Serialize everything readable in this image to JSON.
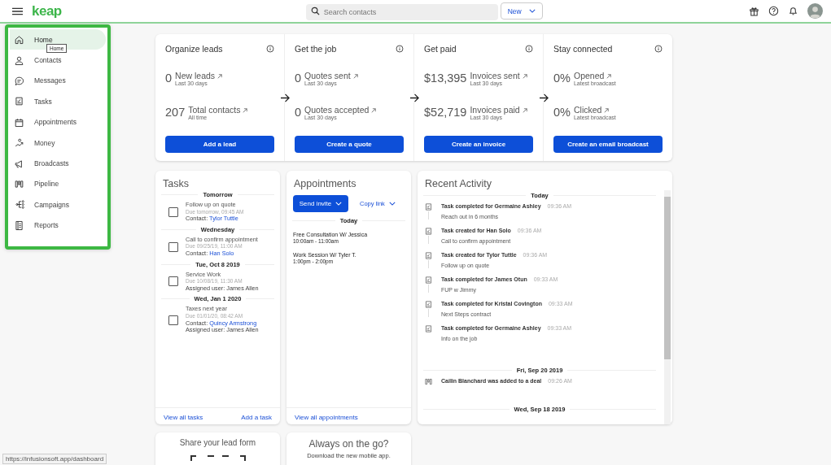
{
  "topbar": {
    "logo": "keap",
    "search": {
      "placeholder": "Search contacts"
    },
    "new_button": "New"
  },
  "sidebar": {
    "items": [
      {
        "label": "Home",
        "selected": true
      },
      {
        "label": "Contacts",
        "selected": false
      },
      {
        "label": "Messages",
        "selected": false
      },
      {
        "label": "Tasks",
        "selected": false
      },
      {
        "label": "Appointments",
        "selected": false
      },
      {
        "label": "Money",
        "selected": false
      },
      {
        "label": "Broadcasts",
        "selected": false
      },
      {
        "label": "Pipeline",
        "selected": false
      },
      {
        "label": "Campaigns",
        "selected": false
      },
      {
        "label": "Reports",
        "selected": false
      }
    ],
    "tooltip": "Home"
  },
  "summary": [
    {
      "title": "Organize leads",
      "metrics": [
        {
          "value": "0",
          "label": "New leads",
          "sub": "Last 30 days"
        },
        {
          "value": "207",
          "label": "Total contacts",
          "sub": "All time"
        }
      ],
      "button": "Add a lead"
    },
    {
      "title": "Get the job",
      "metrics": [
        {
          "value": "0",
          "label": "Quotes sent",
          "sub": "Last 30 days"
        },
        {
          "value": "0",
          "label": "Quotes accepted",
          "sub": "Last 30 days"
        }
      ],
      "button": "Create a quote"
    },
    {
      "title": "Get paid",
      "metrics": [
        {
          "value": "$13,395",
          "label": "Invoices sent",
          "sub": "Last 30 days"
        },
        {
          "value": "$52,719",
          "label": "Invoices paid",
          "sub": "Last 30 days"
        }
      ],
      "button": "Create an invoice"
    },
    {
      "title": "Stay connected",
      "metrics": [
        {
          "value": "0%",
          "label": "Opened",
          "sub": "Latest broadcast"
        },
        {
          "value": "0%",
          "label": "Clicked",
          "sub": "Latest broadcast"
        }
      ],
      "button": "Create an email broadcast"
    }
  ],
  "tasks": {
    "title": "Tasks",
    "groups": [
      {
        "heading": "Tomorrow",
        "items": [
          {
            "title": "Follow up on quote",
            "due": "Due tomorrow, 09:45 AM",
            "checked": false,
            "lines": [
              {
                "label": "Contact:",
                "value": "Tylor Tuttle",
                "link": true
              }
            ]
          }
        ]
      },
      {
        "heading": "Wednesday",
        "items": [
          {
            "title": "Call to confirm appointment",
            "due": "Due 09/25/19, 11:00 AM",
            "checked": false,
            "lines": [
              {
                "label": "Contact:",
                "value": "Han Solo",
                "link": true
              }
            ]
          }
        ]
      },
      {
        "heading": "Tue, Oct 8 2019",
        "items": [
          {
            "title": "Service Work",
            "due": "Due 10/08/19, 11:30 AM",
            "checked": false,
            "lines": [
              {
                "label": "Assigned user:",
                "value": "James Allen",
                "link": false
              }
            ]
          }
        ]
      },
      {
        "heading": "Wed, Jan 1 2020",
        "items": [
          {
            "title": "Taxes next year",
            "due": "Due 01/01/20, 08:42 AM",
            "checked": false,
            "lines": [
              {
                "label": "Contact:",
                "value": "Quincy Armstrong",
                "link": true
              },
              {
                "label": "Assigned user:",
                "value": "James Allen",
                "link": false
              }
            ]
          }
        ]
      }
    ],
    "footer": [
      "View all tasks",
      "Add a task"
    ]
  },
  "appointments": {
    "title": "Appointments",
    "send_invite": "Send invite",
    "copy_link": "Copy link",
    "heading": "Today",
    "items": [
      {
        "title": "Free Consultation W/ Jessica",
        "time": "10:00am - 11:00am"
      },
      {
        "title": "Work Session W/ Tyler T.",
        "time": "1:00pm - 2:00pm"
      }
    ],
    "footer": "View all appointments"
  },
  "recent_activity": {
    "title": "Recent Activity",
    "groups": [
      {
        "heading": "Today",
        "items": [
          {
            "kind": "task",
            "text": "Task completed for Germaine Ashley",
            "time": "09:36 AM",
            "note": "Reach out in 6 months"
          },
          {
            "kind": "task",
            "text": "Task created for Han Solo",
            "time": "09:36 AM",
            "note": "Call to confirm appointment"
          },
          {
            "kind": "task",
            "text": "Task created for Tylor Tuttle",
            "time": "09:36 AM",
            "note": "Follow up on quote"
          },
          {
            "kind": "task",
            "text": "Task completed for James Otun",
            "time": "09:33 AM",
            "note": "FUP w Jimmy"
          },
          {
            "kind": "task",
            "text": "Task completed for Kristal Covington",
            "time": "09:33 AM",
            "note": "Next Steps contract"
          },
          {
            "kind": "task",
            "text": "Task completed for Germaine Ashley",
            "time": "09:33 AM",
            "note": "Info on the job"
          }
        ]
      },
      {
        "heading": "Fri, Sep 20 2019",
        "items": [
          {
            "kind": "deal",
            "text": "Cailin Blanchard was added to a deal",
            "time": "09:26 AM"
          }
        ]
      },
      {
        "heading": "Wed, Sep 18 2019"
      }
    ]
  },
  "bottom_cards": [
    {
      "title": "Share your lead form"
    },
    {
      "title": "Always on the go?",
      "subtitle": "Download the new mobile app."
    }
  ],
  "status_url": "https://infusionsoft.app/dashboard"
}
